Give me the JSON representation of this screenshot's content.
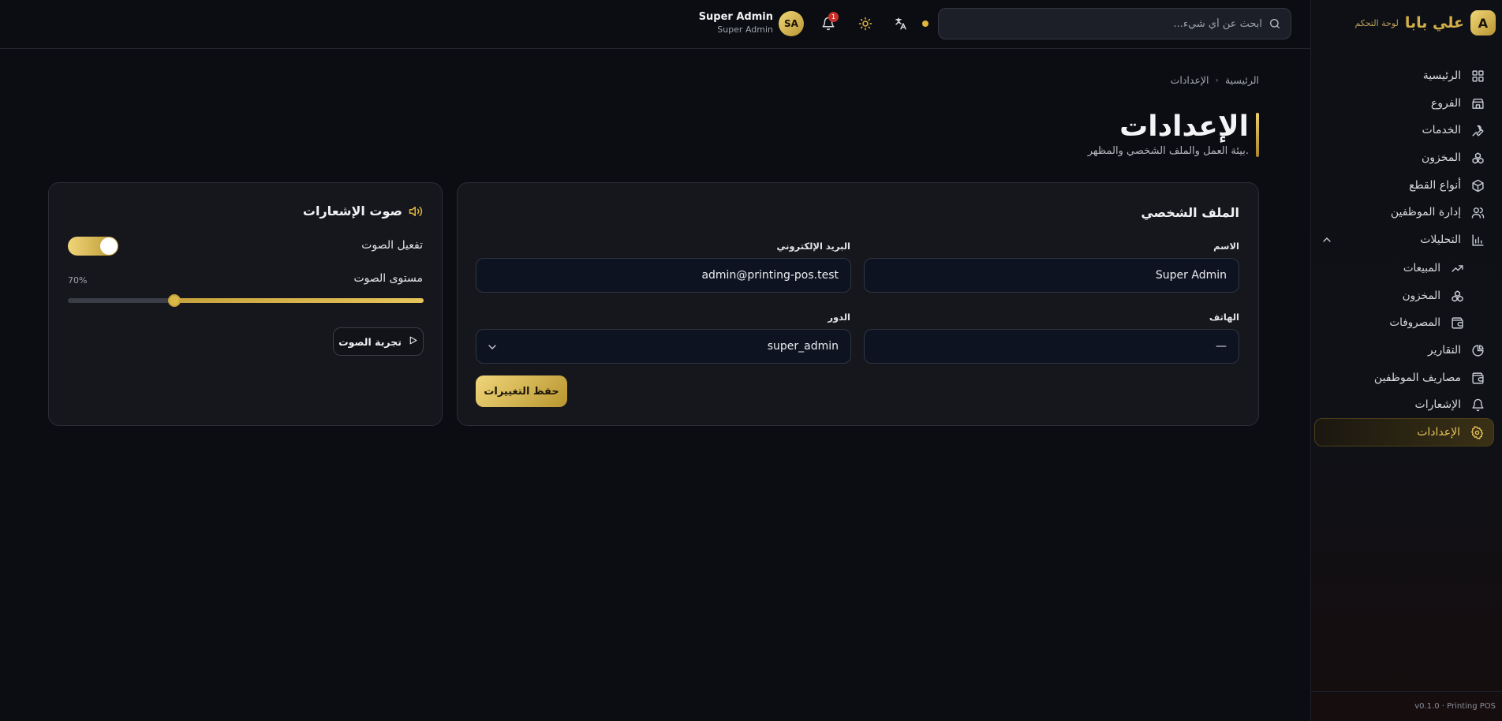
{
  "brand": {
    "logo_letter": "A",
    "name": "علي بابا",
    "dashboard_label": "لوحة التحكم"
  },
  "sidebar": {
    "items": [
      {
        "label": "الرئيسية",
        "icon": "grid-icon"
      },
      {
        "label": "الفروع",
        "icon": "store-icon"
      },
      {
        "label": "الخدمات",
        "icon": "wrench-icon"
      },
      {
        "label": "المخزون",
        "icon": "boxes-icon"
      },
      {
        "label": "أنواع القطع",
        "icon": "package-icon"
      },
      {
        "label": "إدارة الموظفين",
        "icon": "users-icon"
      },
      {
        "label": "التحليلات",
        "icon": "bar-chart-icon",
        "expanded": true
      },
      {
        "label": "المبيعات",
        "icon": "trending-up-icon",
        "sub": true
      },
      {
        "label": "المخزون",
        "icon": "boxes-icon",
        "sub": true
      },
      {
        "label": "المصروفات",
        "icon": "wallet-icon",
        "sub": true
      },
      {
        "label": "التقارير",
        "icon": "pie-chart-icon"
      },
      {
        "label": "مصاريف الموظفين",
        "icon": "wallet-icon"
      },
      {
        "label": "الإشعارات",
        "icon": "bell-icon"
      },
      {
        "label": "الإعدادات",
        "icon": "gear-icon",
        "active": true
      }
    ],
    "footer": "v0.1.0 · Printing POS"
  },
  "topbar": {
    "search_placeholder": "ابحث عن أي شيء...",
    "notification_count": "1",
    "user_initials": "SA",
    "user_name": "Super Admin",
    "user_role": "Super Admin"
  },
  "breadcrumb": {
    "home": "الرئيسية",
    "current": "الإعدادات"
  },
  "page": {
    "title": "الإعدادات",
    "subtitle": "بيئة العمل والملف الشخصي والمظهر."
  },
  "profile": {
    "title": "الملف الشخصي",
    "name_label": "الاسم",
    "name_value": "Super Admin",
    "email_label": "البريد الإلكتروني",
    "email_value": "admin@printing-pos.test",
    "phone_label": "الهاتف",
    "phone_value": "—",
    "role_label": "الدور",
    "role_value": "super_admin",
    "save_label": "حفظ التغييرات"
  },
  "sound": {
    "title": "صوت الإشعارات",
    "enable_label": "تفعيل الصوت",
    "enabled": true,
    "volume_label": "مستوى الصوت",
    "volume_text": "70%",
    "volume_fraction": 0.7,
    "test_label": "تجربة الصوت"
  },
  "colors": {
    "accent": "#e0b640",
    "background": "#0b0d12",
    "card": "#16171d"
  }
}
